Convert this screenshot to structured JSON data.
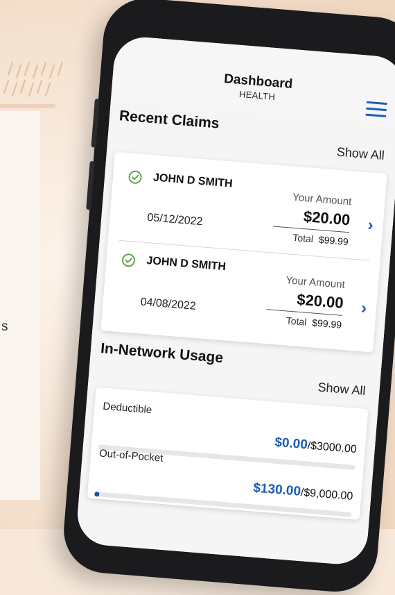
{
  "app": {
    "title": "Dashboard",
    "subtitle": "HEALTH"
  },
  "left_fragment": "s",
  "recent_claims": {
    "title": "Recent Claims",
    "show_all": "Show All",
    "items": [
      {
        "name": "JOHN D SMITH",
        "date": "05/12/2022",
        "your_amount_label": "Your Amount",
        "your_amount": "$20.00",
        "total_label": "Total",
        "total": "$99.99"
      },
      {
        "name": "JOHN D SMITH",
        "date": "04/08/2022",
        "your_amount_label": "Your Amount",
        "your_amount": "$20.00",
        "total_label": "Total",
        "total": "$99.99"
      }
    ]
  },
  "in_network": {
    "title": "In-Network Usage",
    "show_all": "Show All",
    "rows": [
      {
        "label": "Deductible",
        "used": "$0.00",
        "limit": "/$3000.00",
        "fraction": 0.0
      },
      {
        "label": "Out-of-Pocket",
        "used": "$130.00",
        "limit": "/$9,000.00",
        "fraction": 0.0144
      }
    ]
  },
  "colors": {
    "accent": "#1c5db8",
    "check": "#5aa54b"
  },
  "icons": {
    "check": "check-circle-icon",
    "chevron": "chevron-right-icon",
    "menu": "hamburger-menu-icon"
  }
}
